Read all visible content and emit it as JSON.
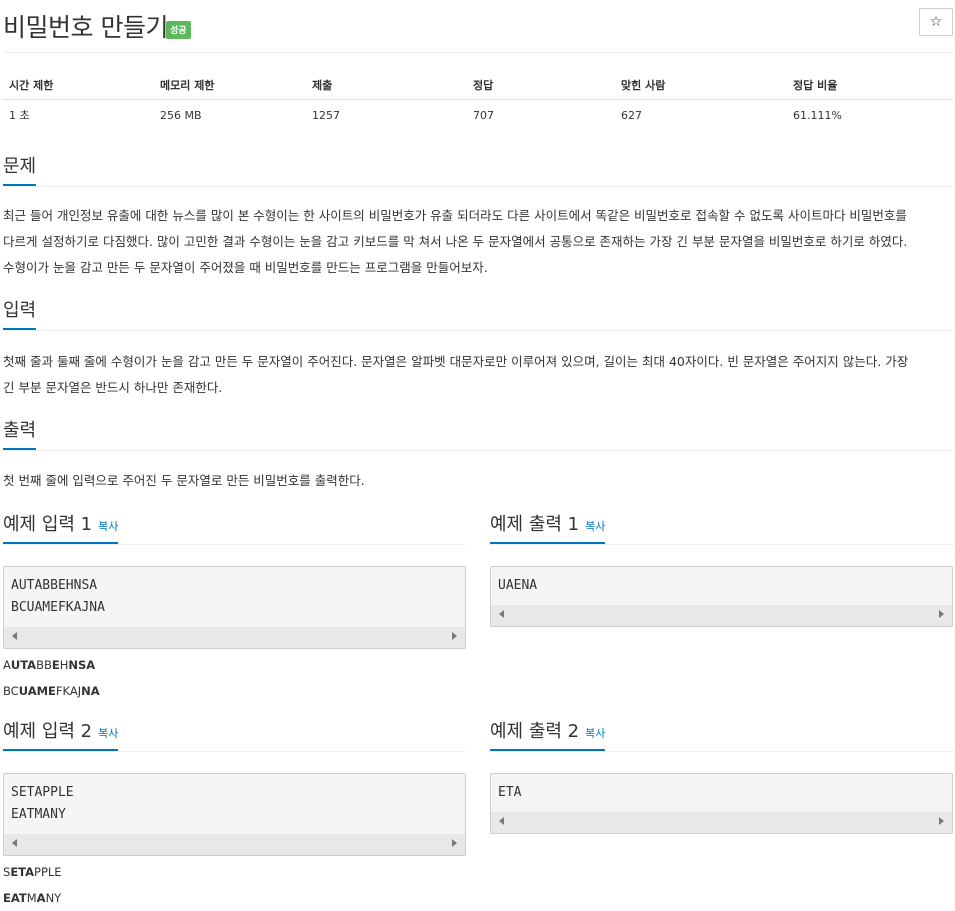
{
  "header": {
    "title": "비밀번호 만들기",
    "badge": "성공",
    "star": "☆"
  },
  "info_table": {
    "headers": [
      "시간 제한",
      "메모리 제한",
      "제출",
      "정답",
      "맞힌 사람",
      "정답 비율"
    ],
    "values": [
      "1 초",
      "256 MB",
      "1257",
      "707",
      "627",
      "61.111%"
    ]
  },
  "problem": {
    "heading": "문제",
    "lines": [
      "최근 들어 개인정보 유출에 대한 뉴스를 많이 본 수형이는 한 사이트의 비밀번호가 유출 되더라도 다른 사이트에서 똑같은 비밀번호로 접속할 수 없도록 사이트마다 비밀번호를",
      "다르게 설정하기로 다짐했다. 많이 고민한 결과 수형이는 눈을 감고 키보드를 막 쳐서 나온 두 문자열에서 공통으로 존재하는 가장 긴 부분 문자열을 비밀번호로 하기로 하였다.",
      "수형이가 눈을 감고 만든 두 문자열이 주어졌을 때 비밀번호를 만드는 프로그램을 만들어보자."
    ]
  },
  "input": {
    "heading": "입력",
    "lines": [
      "첫째 줄과 둘째 줄에 수형이가 눈을 감고 만든 두 문자열이 주어진다. 문자열은 알파벳 대문자로만 이루어져 있으며, 길이는 최대 40자이다. 빈 문자열은 주어지지 않는다. 가장",
      "긴 부분 문자열은 반드시 하나만 존재한다."
    ]
  },
  "output": {
    "heading": "출력",
    "lines": [
      "첫 번째 줄에 입력으로 주어진 두 문자열로 만든 비밀번호를 출력한다."
    ]
  },
  "samples": [
    {
      "input_heading": "예제 입력 1",
      "output_heading": "예제 출력 1",
      "copy_label": "복사",
      "input_text": "AUTABBEHNSA\nBCUAMEFKAJNA",
      "output_text": "UAENA",
      "explain": [
        [
          {
            "t": "A",
            "b": false
          },
          {
            "t": "UTA",
            "b": true
          },
          {
            "t": "BB",
            "b": false
          },
          {
            "t": "E",
            "b": true
          },
          {
            "t": "H",
            "b": false
          },
          {
            "t": "NSA",
            "b": true
          }
        ],
        [
          {
            "t": "BC",
            "b": false
          },
          {
            "t": "UAME",
            "b": true
          },
          {
            "t": "FKAJ",
            "b": false
          },
          {
            "t": "NA",
            "b": true
          }
        ]
      ]
    },
    {
      "input_heading": "예제 입력 2",
      "output_heading": "예제 출력 2",
      "copy_label": "복사",
      "input_text": "SETAPPLE\nEATMANY",
      "output_text": "ETA",
      "explain": [
        [
          {
            "t": "S",
            "b": false
          },
          {
            "t": "ETA",
            "b": true
          },
          {
            "t": "PPLE",
            "b": false
          }
        ],
        [
          {
            "t": "EAT",
            "b": true
          },
          {
            "t": "M",
            "b": false
          },
          {
            "t": "A",
            "b": true
          },
          {
            "t": "NY",
            "b": false
          }
        ]
      ]
    }
  ]
}
